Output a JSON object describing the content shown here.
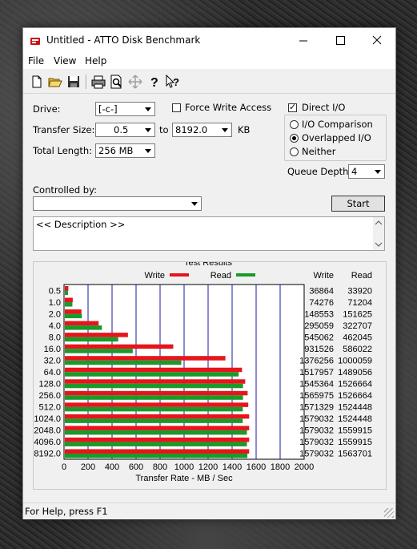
{
  "window": {
    "title": "Untitled - ATTO Disk Benchmark",
    "controls": [
      "minimize",
      "maximize",
      "close"
    ]
  },
  "menu": {
    "items": [
      "File",
      "View",
      "Help"
    ]
  },
  "toolbar": {
    "icons": [
      "new-icon",
      "open-icon",
      "save-icon",
      "print-icon",
      "print-preview-icon",
      "move-icon",
      "help-icon",
      "context-help-icon"
    ]
  },
  "settings": {
    "drive_label": "Drive:",
    "drive_value": "[-c-]",
    "force_write_label": "Force Write Access",
    "force_write_checked": false,
    "transfer_size_label": "Transfer Size:",
    "transfer_from": "0.5",
    "to_label": "to",
    "transfer_to": "8192.0",
    "kb_label": "KB",
    "total_length_label": "Total Length:",
    "total_length_value": "256 MB",
    "direct_io_label": "Direct I/O",
    "direct_io_checked": true,
    "io_modes": [
      {
        "label": "I/O Comparison",
        "selected": false
      },
      {
        "label": "Overlapped I/O",
        "selected": true
      },
      {
        "label": "Neither",
        "selected": false
      }
    ],
    "queue_depth_label": "Queue Depth:",
    "queue_depth_value": "4",
    "controlled_by_label": "Controlled by:",
    "controlled_by_value": "",
    "start_label": "Start",
    "description": "<< Description >>"
  },
  "results": {
    "group_title": "Test Results",
    "legend_write": "Write",
    "legend_read": "Read",
    "col_write": "Write",
    "col_read": "Read",
    "write_color": "#e8141b",
    "read_color": "#1a9a2a",
    "rows": [
      {
        "size": "0.5",
        "write": "36864",
        "read": "33920"
      },
      {
        "size": "1.0",
        "write": "74276",
        "read": "71204"
      },
      {
        "size": "2.0",
        "write": "148553",
        "read": "151625"
      },
      {
        "size": "4.0",
        "write": "295059",
        "read": "322707"
      },
      {
        "size": "8.0",
        "write": "545062",
        "read": "462045"
      },
      {
        "size": "16.0",
        "write": "931526",
        "read": "586022"
      },
      {
        "size": "32.0",
        "write": "1376256",
        "read": "1000059"
      },
      {
        "size": "64.0",
        "write": "1517957",
        "read": "1489056"
      },
      {
        "size": "128.0",
        "write": "1545364",
        "read": "1526664"
      },
      {
        "size": "256.0",
        "write": "1565975",
        "read": "1526664"
      },
      {
        "size": "512.0",
        "write": "1571329",
        "read": "1524448"
      },
      {
        "size": "1024.0",
        "write": "1579032",
        "read": "1524448"
      },
      {
        "size": "2048.0",
        "write": "1579032",
        "read": "1559915"
      },
      {
        "size": "4096.0",
        "write": "1579032",
        "read": "1559915"
      },
      {
        "size": "8192.0",
        "write": "1579032",
        "read": "1563701"
      }
    ]
  },
  "chart_data": {
    "type": "bar",
    "categories": [
      "0.5",
      "1.0",
      "2.0",
      "4.0",
      "8.0",
      "16.0",
      "32.0",
      "64.0",
      "128.0",
      "256.0",
      "512.0",
      "1024.0",
      "2048.0",
      "4096.0",
      "8192.0"
    ],
    "series": [
      {
        "name": "Write",
        "values": [
          36.0,
          72.5,
          145.1,
          288.1,
          532.3,
          909.7,
          1344.0,
          1482.4,
          1509.1,
          1529.3,
          1534.5,
          1542.0,
          1542.0,
          1542.0,
          1542.0
        ]
      },
      {
        "name": "Read",
        "values": [
          33.1,
          69.5,
          148.1,
          315.1,
          451.2,
          572.3,
          976.6,
          1454.2,
          1490.9,
          1490.9,
          1488.7,
          1488.7,
          1523.4,
          1523.4,
          1527.1
        ]
      }
    ],
    "xlabel": "Transfer Rate - MB / Sec",
    "xlim": [
      0,
      2000
    ],
    "xticks": [
      "0",
      "200",
      "400",
      "600",
      "800",
      "1000",
      "1200",
      "1400",
      "1600",
      "1800",
      "2000"
    ],
    "orientation": "horizontal",
    "grid": true
  },
  "statusbar": {
    "text": "For Help, press F1"
  }
}
